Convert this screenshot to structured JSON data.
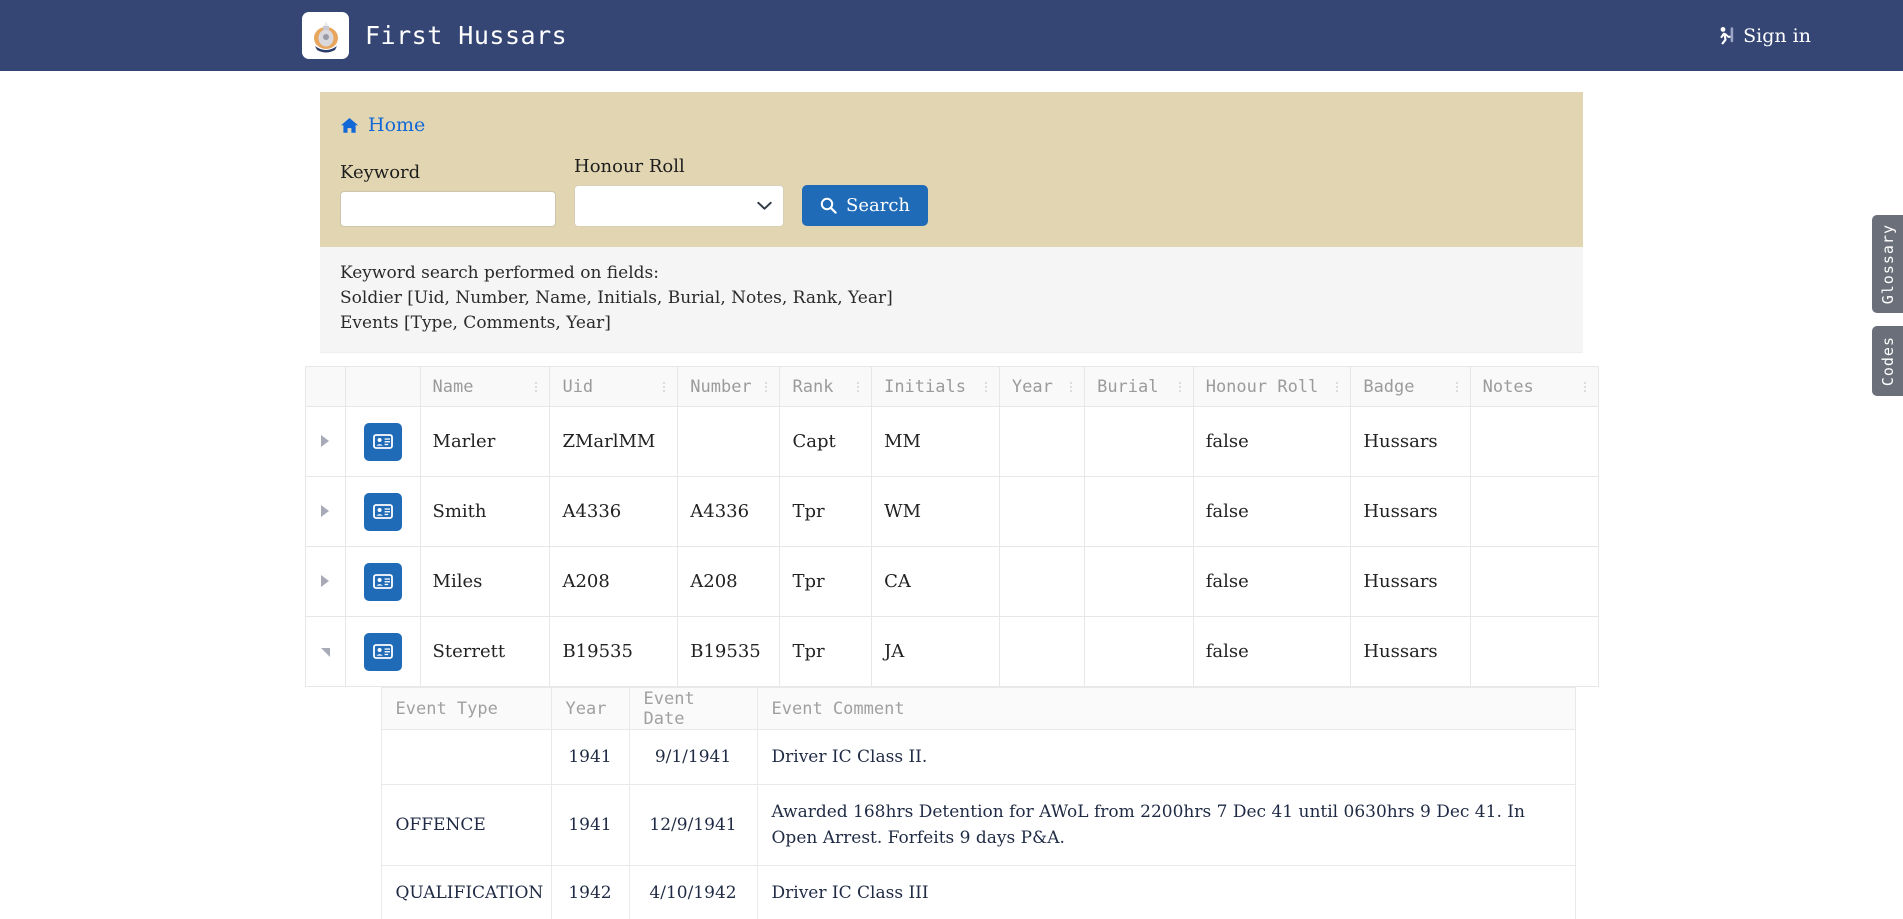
{
  "header": {
    "brand_title": "First Hussars",
    "badge_icon": "regimental-badge-icon",
    "signin_label": "Sign in",
    "signin_icon": "sign-in-icon",
    "background_color": "#354674"
  },
  "sidetabs": [
    {
      "label": "Glossary"
    },
    {
      "label": "Codes"
    }
  ],
  "panel": {
    "background_color": "#e2d6b2",
    "breadcrumb": {
      "label": "Home",
      "icon": "home-icon",
      "color": "#1268d6"
    },
    "keyword": {
      "label": "Keyword",
      "value": "",
      "placeholder": ""
    },
    "honour_roll": {
      "label": "Honour Roll",
      "value": "",
      "options": [
        ""
      ]
    },
    "search_button": {
      "label": "Search",
      "icon": "search-icon",
      "color": "#1f6bb8"
    }
  },
  "info": {
    "line1": "Keyword search performed on fields:",
    "line2": "Soldier [Uid, Number, Name, Initials, Burial, Notes, Rank, Year]",
    "line3": "Events [Type, Comments, Year]"
  },
  "results_table": {
    "columns": [
      "Name",
      "Uid",
      "Number",
      "Rank",
      "Initials",
      "Year",
      "Burial",
      "Honour Roll",
      "Badge",
      "Notes"
    ],
    "rows": [
      {
        "expanded": false,
        "toggle_icon": "expand-triangle-icon",
        "detail_icon": "id-card-icon",
        "Name": "Marler",
        "Uid": "ZMarlMM",
        "Number": "",
        "Rank": "Capt",
        "Initials": "MM",
        "Year": "",
        "Burial": "",
        "Honour Roll": "false",
        "Badge": "Hussars",
        "Notes": ""
      },
      {
        "expanded": false,
        "toggle_icon": "expand-triangle-icon",
        "detail_icon": "id-card-icon",
        "Name": "Smith",
        "Uid": "A4336",
        "Number": "A4336",
        "Rank": "Tpr",
        "Initials": "WM",
        "Year": "",
        "Burial": "",
        "Honour Roll": "false",
        "Badge": "Hussars",
        "Notes": ""
      },
      {
        "expanded": false,
        "toggle_icon": "expand-triangle-icon",
        "detail_icon": "id-card-icon",
        "Name": "Miles",
        "Uid": "A208",
        "Number": "A208",
        "Rank": "Tpr",
        "Initials": "CA",
        "Year": "",
        "Burial": "",
        "Honour Roll": "false",
        "Badge": "Hussars",
        "Notes": ""
      },
      {
        "expanded": true,
        "toggle_icon": "collapse-triangle-icon",
        "detail_icon": "id-card-icon",
        "Name": "Sterrett",
        "Uid": "B19535",
        "Number": "B19535",
        "Rank": "Tpr",
        "Initials": "JA",
        "Year": "",
        "Burial": "",
        "Honour Roll": "false",
        "Badge": "Hussars",
        "Notes": ""
      }
    ]
  },
  "events_table": {
    "columns": [
      "Event Type",
      "Year",
      "Event Date",
      "Event Comment"
    ],
    "rows": [
      {
        "Event Type": "",
        "Year": "1941",
        "Event Date": "9/1/1941",
        "Event Comment": "Driver IC Class II."
      },
      {
        "Event Type": "OFFENCE",
        "Year": "1941",
        "Event Date": "12/9/1941",
        "Event Comment": "Awarded 168hrs Detention for AWoL from 2200hrs 7 Dec 41 until 0630hrs 9 Dec 41. In Open Arrest. Forfeits 9 days P&A."
      },
      {
        "Event Type": "QUALIFICATION",
        "Year": "1942",
        "Event Date": "4/10/1942",
        "Event Comment": "Driver IC Class III"
      }
    ]
  }
}
